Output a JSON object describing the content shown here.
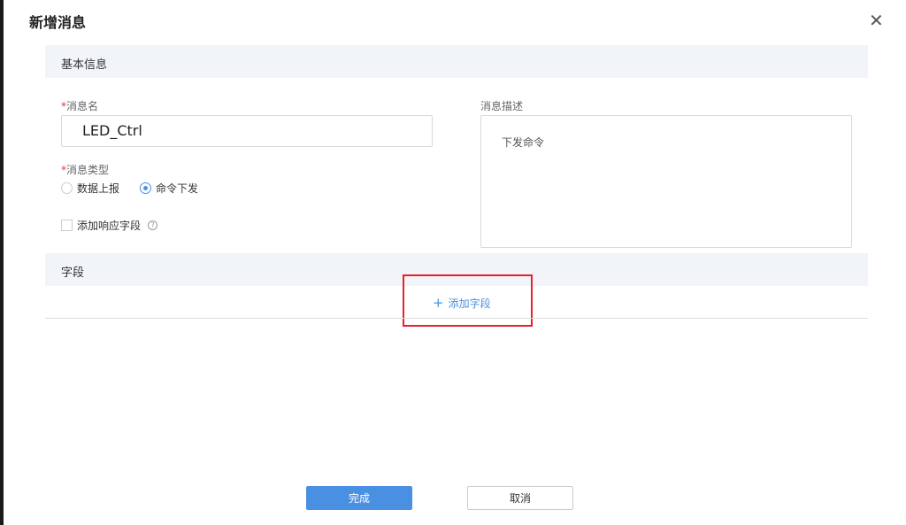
{
  "dialog": {
    "title": "新增消息"
  },
  "basic": {
    "header": "基本信息",
    "name_label": "消息名",
    "name_value": "LED_Ctrl",
    "type_label": "消息类型",
    "type_options": [
      "数据上报",
      "命令下发"
    ],
    "type_selected": "命令下发",
    "response_label": "添加响应字段",
    "help": "?",
    "desc_label": "消息描述",
    "desc_value": "下发命令"
  },
  "fields": {
    "header": "字段",
    "add_label": "添加字段",
    "add_icon": "+"
  },
  "footer": {
    "ok": "完成",
    "cancel": "取消"
  },
  "required_mark": "*",
  "close_icon": "✕"
}
